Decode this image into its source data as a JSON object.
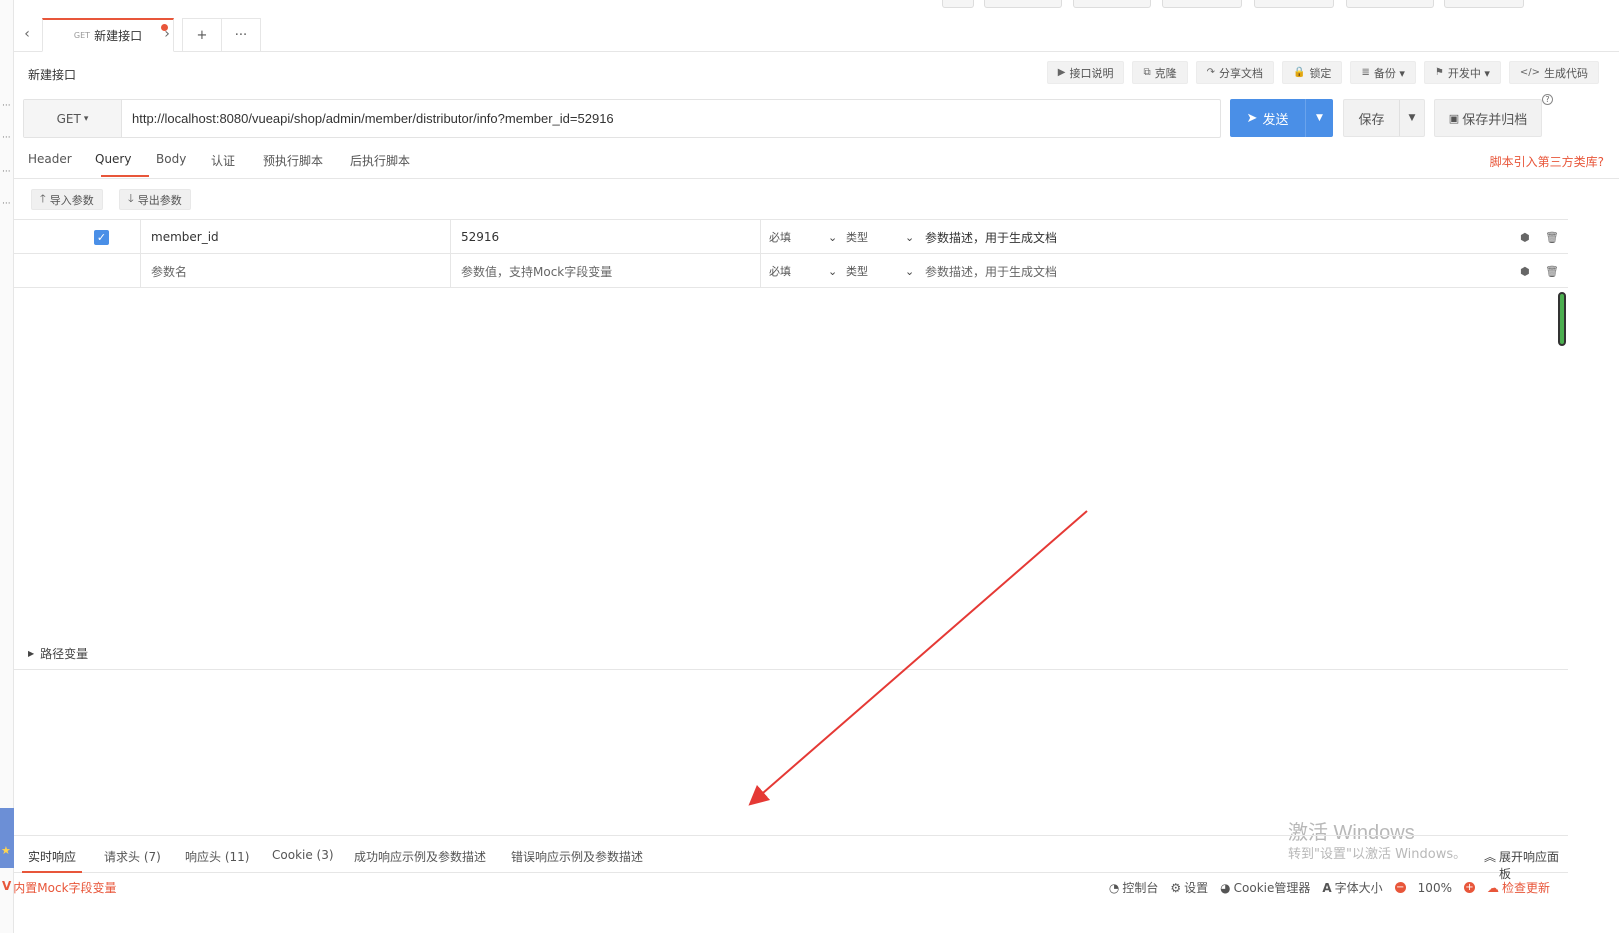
{
  "tabs": {
    "prev": "‹",
    "next": "›",
    "active": {
      "method": "GET",
      "name": "新建接口"
    },
    "add": "+",
    "more": "···"
  },
  "title": "新建接口",
  "actions": [
    {
      "icon": "play-icon",
      "glyph": "▶",
      "label": "接口说明"
    },
    {
      "icon": "copy-icon",
      "glyph": "⧉",
      "label": "克隆"
    },
    {
      "icon": "share-icon",
      "glyph": "↷",
      "label": "分享文档"
    },
    {
      "icon": "lock-icon",
      "glyph": "🔒",
      "label": "锁定"
    },
    {
      "icon": "database-icon",
      "glyph": "≣",
      "label": "备份 ▾"
    },
    {
      "icon": "flag-icon",
      "glyph": "⚑",
      "label": "开发中 ▾"
    },
    {
      "icon": "code-icon",
      "glyph": "</>",
      "label": "生成代码"
    }
  ],
  "request": {
    "method": "GET",
    "method_caret": "▾",
    "url": "http://localhost:8080/vueapi/shop/admin/member/distributor/info?member_id=52916",
    "send_label": "发送",
    "save_label": "保存",
    "archive_label": "保存并归档",
    "help": "?"
  },
  "request_tabs": [
    "Header",
    "Query",
    "Body",
    "认证",
    "预执行脚本",
    "后执行脚本"
  ],
  "script_link": "脚本引入第三方类库?",
  "import_label": "导入参数",
  "export_label": "导出参数",
  "params": [
    {
      "checked": true,
      "name": "member_id",
      "value": "52916",
      "required": "必填",
      "type": "类型",
      "desc": "参数描述，用于生成文档"
    },
    {
      "checked": false,
      "name": "参数名",
      "value": "参数值，支持Mock字段变量",
      "required": "必填",
      "type": "类型",
      "desc": "参数描述，用于生成文档"
    }
  ],
  "path_vars_label": "路径变量",
  "response_tabs": [
    "实时响应",
    "请求头 (7)",
    "响应头 (11)",
    "Cookie (3)",
    "成功响应示例及参数描述",
    "错误响应示例及参数描述"
  ],
  "expand_panel": "展开响应面板",
  "watermark": {
    "line1": "激活 Windows",
    "line2": "转到\"设置\"以激活 Windows。"
  },
  "status": {
    "mock": "内置Mock字段变量",
    "console": "控制台",
    "settings": "设置",
    "cookie": "Cookie管理器",
    "font_size": "字体大小",
    "zoom": "100%",
    "update": "检查更新"
  },
  "colors": {
    "accent": "#e8563a",
    "primary": "#4a8fe7"
  }
}
